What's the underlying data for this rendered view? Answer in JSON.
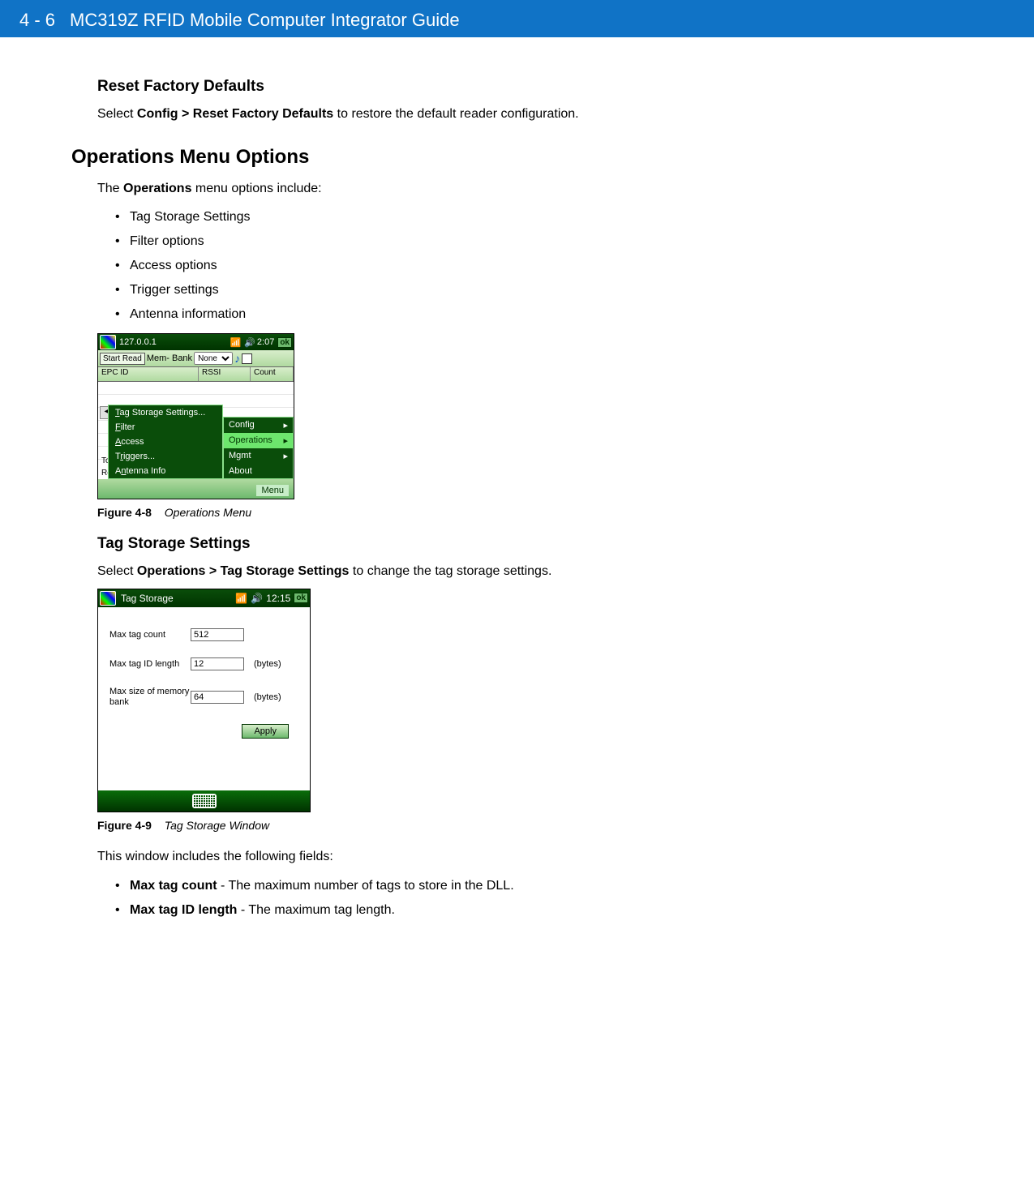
{
  "header": {
    "page_number": "4 - 6",
    "title": "MC319Z RFID Mobile Computer Integrator Guide"
  },
  "section1": {
    "heading": "Reset Factory Defaults",
    "text_prefix": "Select ",
    "text_bold": "Config > Reset Factory Defaults",
    "text_suffix": " to restore the default reader configuration."
  },
  "section2": {
    "heading": "Operations Menu Options",
    "intro_prefix": "The ",
    "intro_bold": "Operations",
    "intro_suffix": " menu options include:",
    "bullets": [
      "Tag Storage Settings",
      "Filter options",
      "Access options",
      "Trigger settings",
      "Antenna information"
    ]
  },
  "fig48": {
    "label": "Figure 4-8",
    "caption": "Operations Menu",
    "titlebar": {
      "ip": "127.0.0.1",
      "time": "2:07",
      "ok": "ok"
    },
    "toolbar": {
      "start_read": "Start Read",
      "membank": "Mem- Bank",
      "select_value": "None"
    },
    "columns": {
      "c1": "EPC ID",
      "c2": "RSSI",
      "c3": "Count"
    },
    "summary": {
      "tot": "Tot",
      "rea": "Rea"
    },
    "submenu": [
      "Tag Storage Settings...",
      "Filter",
      "Access",
      "Triggers...",
      "Antenna Info"
    ],
    "mainmenu": [
      "Config",
      "Operations",
      "Mgmt",
      "About"
    ],
    "menu_label": "Menu"
  },
  "section3": {
    "heading": "Tag Storage Settings",
    "text_prefix": "Select ",
    "text_bold": "Operations > Tag Storage Settings",
    "text_suffix": " to change the tag storage settings."
  },
  "fig49": {
    "label": "Figure 4-9",
    "caption": "Tag Storage Window",
    "titlebar": {
      "title": "Tag Storage",
      "time": "12:15",
      "ok": "ok"
    },
    "rows": [
      {
        "label": "Max tag count",
        "value": "512",
        "unit": ""
      },
      {
        "label": "Max tag ID length",
        "value": "12",
        "unit": "(bytes)"
      },
      {
        "label": "Max size of memory bank",
        "value": "64",
        "unit": "(bytes)"
      }
    ],
    "apply": "Apply"
  },
  "section4": {
    "intro": "This window includes the following fields:",
    "items": [
      {
        "bold": "Max tag count",
        "rest": " - The maximum number of tags to store in the DLL."
      },
      {
        "bold": "Max tag ID length",
        "rest": " - The maximum tag length."
      }
    ]
  }
}
